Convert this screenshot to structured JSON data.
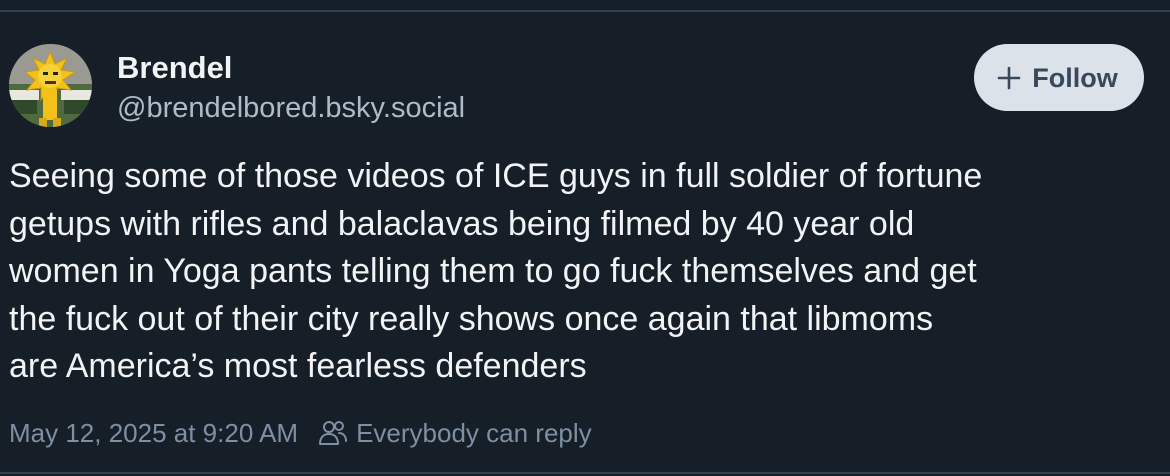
{
  "author": {
    "display_name": "Brendel",
    "handle": "@brendelbored.bsky.social",
    "avatar_icon": "avatar-mascot-image"
  },
  "follow_button": {
    "label": "Follow",
    "icon": "plus-icon"
  },
  "post": {
    "lines": [
      "Seeing some of those videos of ICE guys in full soldier of fortune",
      "getups with rifles and balaclavas being filmed by 40 year old",
      "women in Yoga pants telling them to go fuck themselves and get",
      "the fuck out of their city really shows once again that libmoms",
      "are America’s most fearless defenders"
    ]
  },
  "meta": {
    "timestamp": "May 12, 2025 at 9:20 AM",
    "reply_setting": "Everybody can reply",
    "reply_icon": "people-icon"
  },
  "colors": {
    "background": "#161e27",
    "text_primary": "#f1f3f5",
    "text_secondary": "#aebbc9",
    "text_muted": "#7d8fa3",
    "follow_bg": "#dce2ea",
    "follow_text": "#39485b",
    "divider": "#2e4052"
  }
}
